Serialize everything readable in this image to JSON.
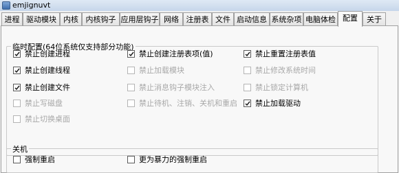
{
  "window": {
    "title": "emjignuvt"
  },
  "tabs": [
    {
      "label": "进程",
      "active": false
    },
    {
      "label": "驱动模块",
      "active": false
    },
    {
      "label": "内核",
      "active": false
    },
    {
      "label": "内核钩子",
      "active": false
    },
    {
      "label": "应用层钩子",
      "active": false
    },
    {
      "label": "网络",
      "active": false
    },
    {
      "label": "注册表",
      "active": false
    },
    {
      "label": "文件",
      "active": false
    },
    {
      "label": "启动信息",
      "active": false
    },
    {
      "label": "系统杂项",
      "active": false
    },
    {
      "label": "电脑体检",
      "active": false
    },
    {
      "label": "配置",
      "active": true
    },
    {
      "label": "关于",
      "active": false
    }
  ],
  "temp_config": {
    "caption": "临时配置(64位系统仅支持部分功能)",
    "options": [
      {
        "label": "禁止创建进程",
        "checked": true,
        "enabled": true
      },
      {
        "label": "禁止创建线程",
        "checked": true,
        "enabled": true
      },
      {
        "label": "禁止创建文件",
        "checked": true,
        "enabled": true
      },
      {
        "label": "禁止写磁盘",
        "checked": false,
        "enabled": false
      },
      {
        "label": "禁止切换桌面",
        "checked": false,
        "enabled": false
      },
      {
        "label": "禁止创建注册表项(值)",
        "checked": true,
        "enabled": true
      },
      {
        "label": "禁止加载模块",
        "checked": false,
        "enabled": false
      },
      {
        "label": "禁止消息钩子模块注入",
        "checked": false,
        "enabled": false
      },
      {
        "label": "禁止待机、注销、关机和重启",
        "checked": false,
        "enabled": false
      },
      {
        "label": "禁止重置注册表值",
        "checked": true,
        "enabled": true
      },
      {
        "label": "禁止修改系统时间",
        "checked": false,
        "enabled": false
      },
      {
        "label": "禁止锁定计算机",
        "checked": false,
        "enabled": false
      },
      {
        "label": "禁止加载驱动",
        "checked": true,
        "enabled": true
      }
    ]
  },
  "shutdown": {
    "caption": "关机",
    "options": [
      {
        "label": "强制重启",
        "checked": false,
        "enabled": true
      },
      {
        "label": "更为暴力的强制重启",
        "checked": false,
        "enabled": true
      }
    ]
  },
  "colors": {
    "disabled_text": "#a8a8a8",
    "check_mark": "#1e1e1e"
  },
  "icons": {
    "app": "app-icon",
    "check": "check-icon"
  }
}
